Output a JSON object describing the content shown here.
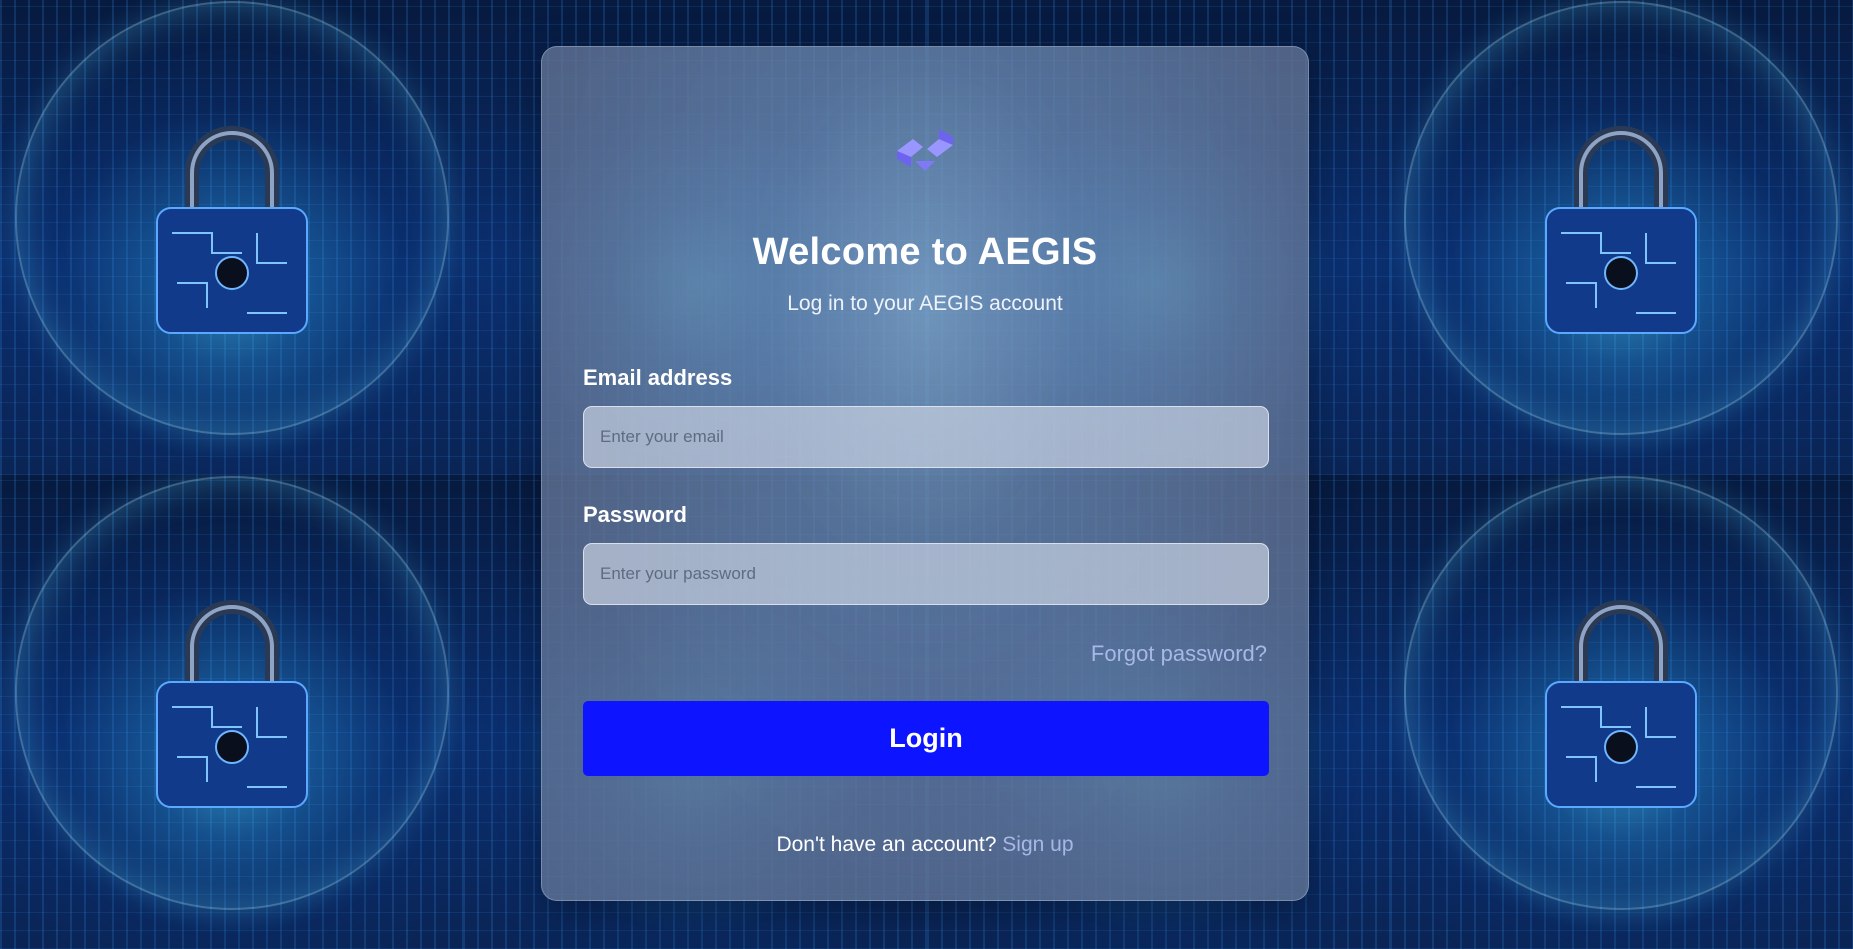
{
  "login": {
    "title": "Welcome to AEGIS",
    "subtitle": "Log in to your AEGIS account",
    "email_label": "Email address",
    "email_placeholder": "Enter your email",
    "email_value": "",
    "password_label": "Password",
    "password_placeholder": "Enter your password",
    "password_value": "",
    "forgot_password": "Forgot password?",
    "login_button": "Login",
    "signup_prompt": "Don't have an account?",
    "signup_link": "Sign up"
  },
  "icons": {
    "logo": "aegis-logo-icon",
    "background": "padlock-icon"
  },
  "colors": {
    "primary_button": "#0d14ff",
    "link": "#a8b8e6",
    "logo_light": "#9a96ff",
    "logo_dark": "#6d63f0"
  }
}
